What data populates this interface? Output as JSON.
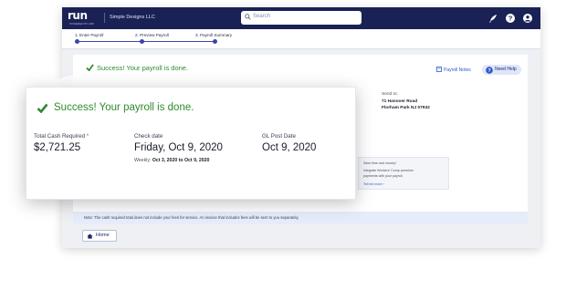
{
  "app": {
    "logo": "run",
    "logo_sub": "POWERED BY ADP",
    "company": "Simple Designs LLC"
  },
  "search": {
    "placeholder": "Search"
  },
  "topbar_icons": [
    "rocket-icon",
    "help-circle-icon",
    "user-icon"
  ],
  "steps": [
    {
      "label": "1. Enter Payroll"
    },
    {
      "label": "2. Preview Payroll"
    },
    {
      "label": "3. Payroll Summary"
    }
  ],
  "summary": {
    "success": "Success! Your payroll is done.",
    "payroll_notes": "Payroll Notes",
    "need_help": "Need Help",
    "send_to_label": "Send to:",
    "send_to_line1": "71 Hanover Road",
    "send_to_line2": "Florham Park NJ 07932",
    "promo_line1": "Save time and money!",
    "promo_line2": "Integrate Workers' Comp premium",
    "promo_line3": "payments with your payroll.",
    "promo_link": "Tell me more",
    "note": "Note: The cash required total does not include your fees for service. An invoice that includes fees will be sent to you separately.",
    "home": "Home"
  },
  "overlay": {
    "success": "Success! Your payroll is done.",
    "total_label": "Total Cash Required",
    "total_marker": "*",
    "total_value": "$2,721.25",
    "check_label": "Check date",
    "check_value": "Friday, Oct 9, 2020",
    "weekly_label": "Weekly:",
    "weekly_range": "Oct 3, 2020 to Oct 9, 2020",
    "gl_label": "GL Post Date",
    "gl_value": "Oct 9, 2020"
  },
  "colors": {
    "nav": "#1a2155",
    "accent": "#3a46a8",
    "success": "#2f8a2f",
    "link": "#2b57c9",
    "required": "#d23a3a"
  }
}
